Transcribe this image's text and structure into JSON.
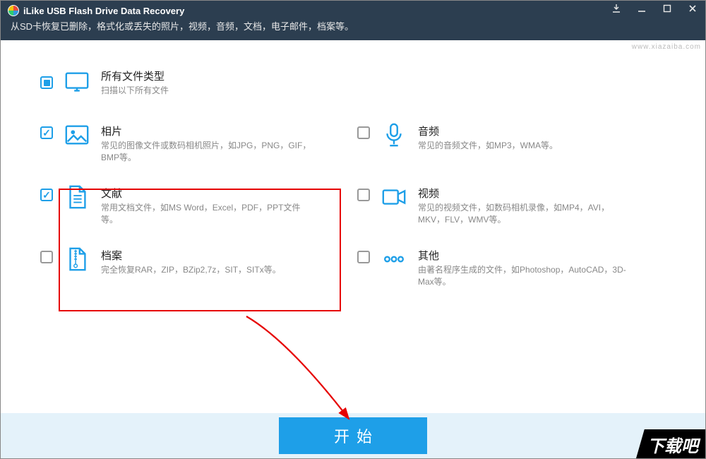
{
  "app": {
    "title": "iLike USB Flash Drive Data Recovery",
    "subtitle": "从SD卡恢复已删除，格式化或丢失的照片，视频，音频，文档，电子邮件，档案等。"
  },
  "all": {
    "label": "所有文件类型",
    "desc": "扫描以下所有文件"
  },
  "types": {
    "photo": {
      "label": "相片",
      "desc": "常见的图像文件或数码相机照片，如JPG，PNG，GIF，BMP等。"
    },
    "audio": {
      "label": "音频",
      "desc": "常见的音频文件，如MP3，WMA等。"
    },
    "document": {
      "label": "文献",
      "desc": "常用文档文件，如MS Word，Excel，PDF，PPT文件等。"
    },
    "video": {
      "label": "视频",
      "desc": "常见的视频文件，如数码相机录像，如MP4，AVI，MKV，FLV，WMV等。"
    },
    "archive": {
      "label": "档案",
      "desc": "完全恢复RAR，ZIP，BZip2,7z，SIT，SITx等。"
    },
    "other": {
      "label": "其他",
      "desc": "由著名程序生成的文件，如Photoshop，AutoCAD，3D-Max等。"
    }
  },
  "footer": {
    "start": "开始"
  },
  "watermark": "www.xiazaiba.com",
  "stamp": "下载吧",
  "colors": {
    "accent": "#1e9fe8",
    "highlight": "#e60000"
  }
}
